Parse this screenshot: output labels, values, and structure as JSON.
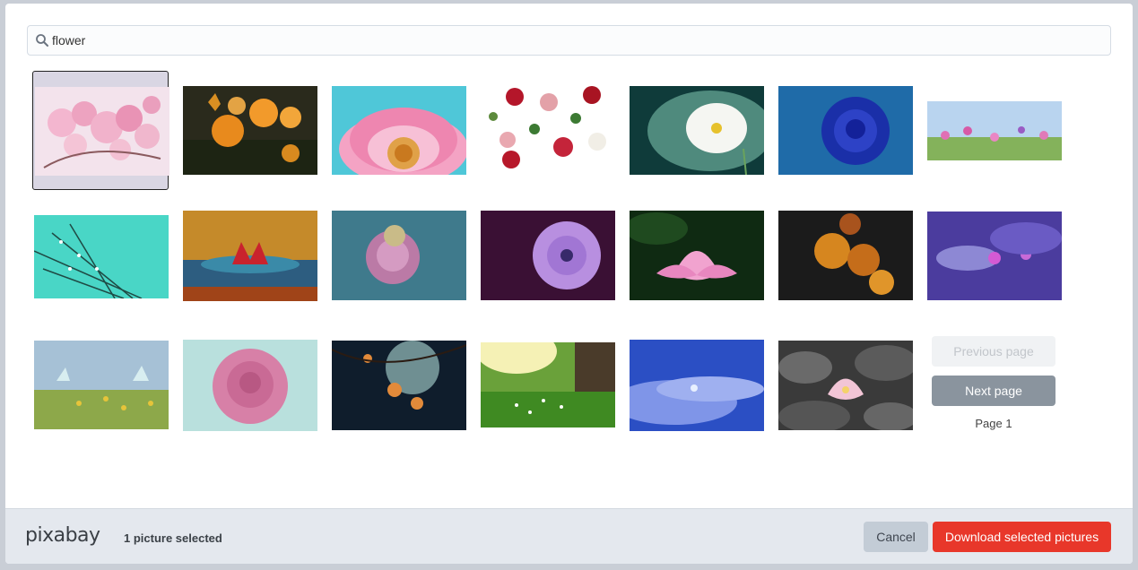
{
  "search": {
    "value": "flower",
    "icon": "search-icon"
  },
  "results": [
    {
      "name": "cherry-blossom",
      "selected": true
    },
    {
      "name": "butterfly-orange-flowers",
      "selected": false
    },
    {
      "name": "pink-gerbera",
      "selected": false
    },
    {
      "name": "vintage-roses",
      "selected": false
    },
    {
      "name": "white-daisy",
      "selected": false
    },
    {
      "name": "blue-rose",
      "selected": false
    },
    {
      "name": "meadow-flowers",
      "selected": false
    },
    {
      "name": "dandelion-dew",
      "selected": false
    },
    {
      "name": "red-water-lily",
      "selected": false
    },
    {
      "name": "pastel-rose",
      "selected": false
    },
    {
      "name": "purple-daisy",
      "selected": false
    },
    {
      "name": "pink-lotus",
      "selected": false
    },
    {
      "name": "orange-roses",
      "selected": false
    },
    {
      "name": "purple-water-lily",
      "selected": false
    },
    {
      "name": "butterflies-meadow",
      "selected": false
    },
    {
      "name": "pink-rose",
      "selected": false
    },
    {
      "name": "blossom-silhouette",
      "selected": false
    },
    {
      "name": "spring-meadow",
      "selected": false
    },
    {
      "name": "blue-petals-drop",
      "selected": false
    },
    {
      "name": "lotus-grayscale",
      "selected": false
    }
  ],
  "pager": {
    "previous_label": "Previous page",
    "next_label": "Next page",
    "page_label": "Page 1"
  },
  "footer": {
    "logo": "pixabay",
    "selected_count": "1 picture selected",
    "cancel_label": "Cancel",
    "download_label": "Download selected pictures"
  },
  "colors": {
    "accent": "#e8372a",
    "next_button": "#8a949e",
    "footer_bg": "#e4e8ee"
  }
}
